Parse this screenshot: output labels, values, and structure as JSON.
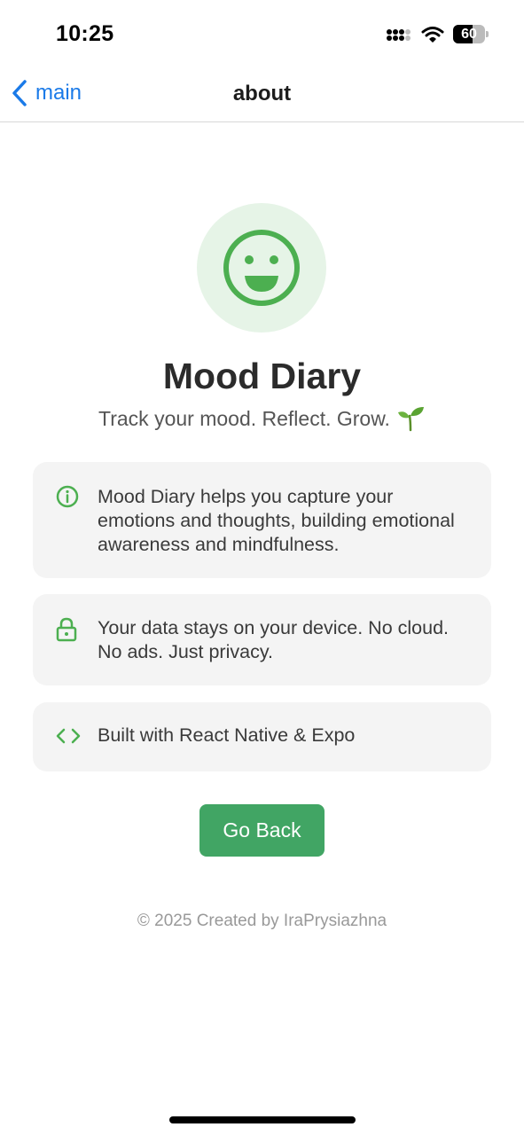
{
  "status_bar": {
    "time": "10:25",
    "battery_level": "60",
    "icons": [
      "signal-icon",
      "wifi-icon",
      "battery-icon"
    ]
  },
  "nav": {
    "back_label": "main",
    "title": "about"
  },
  "app": {
    "logo_icon": "smiley-face-icon",
    "title": "Mood Diary",
    "tagline": "Track your mood. Reflect. Grow.",
    "tagline_emoji": "seedling-icon"
  },
  "cards": [
    {
      "icon": "info-icon",
      "text": "Mood Diary helps you capture your emotions and thoughts, building emotional awareness and mindfulness."
    },
    {
      "icon": "lock-icon",
      "text": "Your data stays on your device. No cloud. No ads. Just privacy."
    },
    {
      "icon": "code-icon",
      "text": "Built with React Native & Expo"
    }
  ],
  "button": {
    "label": "Go Back"
  },
  "footer": {
    "text": "© 2025 Created by IraPrysiazhna"
  },
  "colors": {
    "accent_green": "#41a564",
    "icon_green": "#4caf50",
    "logo_bg": "#e6f4e7",
    "link_blue": "#1a7ae8",
    "card_bg": "#f4f4f4"
  }
}
